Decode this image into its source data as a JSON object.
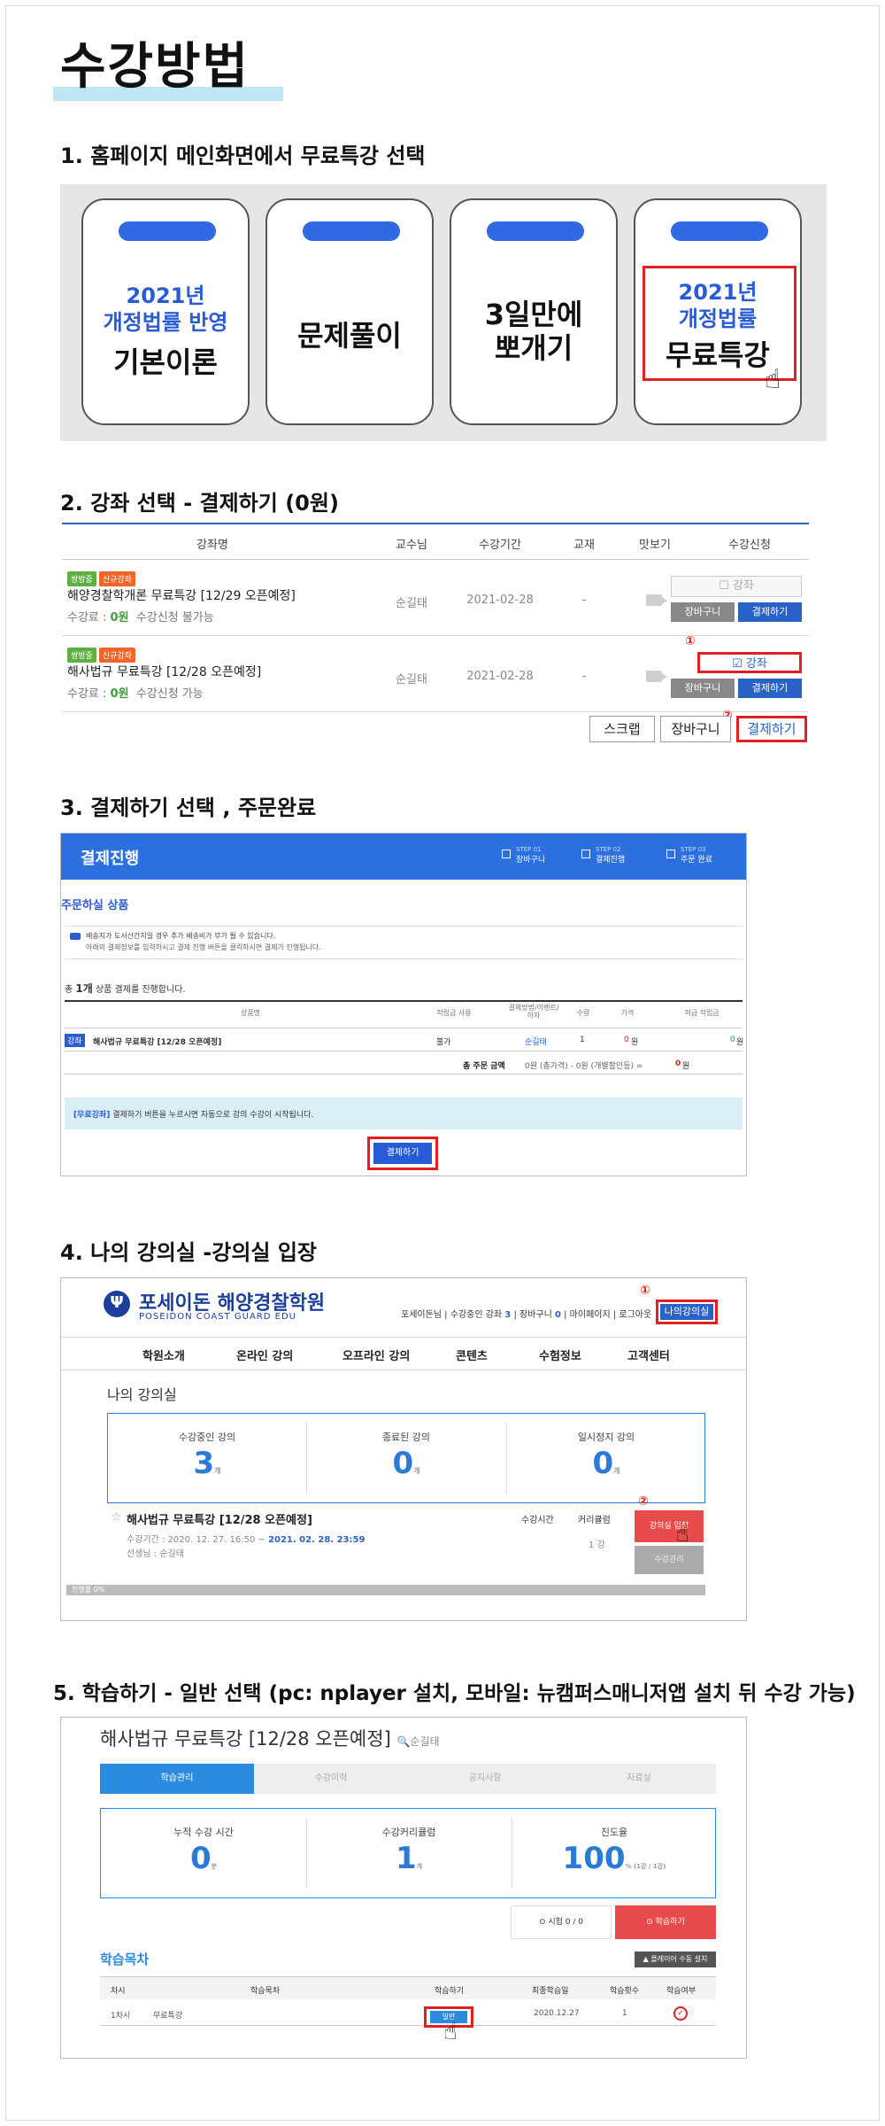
{
  "title": "수강방법",
  "steps": {
    "s1": "1. 홈페이지 메인화면에서 무료특강 선택",
    "s2": "2. 강좌 선택 - 결제하기 (0원)",
    "s3": "3. 결제하기 선택 , 주문완료",
    "s4": "4. 나의 강의실 -강의실 입장",
    "s5": "5. 학습하기 - 일반 선택 (pc: nplayer 설치, 모바일: 뉴캠퍼스매니저앱 설치 뒤 수강 가능)"
  },
  "cards": [
    {
      "blue1": "2021년",
      "blue2": "개정법률 반영",
      "black": "기본이론"
    },
    {
      "black": "문제풀이"
    },
    {
      "black1": "3일만에",
      "black2": "뽀개기"
    },
    {
      "blue1": "2021년",
      "blue2": "개정법률",
      "black": "무료특강"
    }
  ],
  "table2": {
    "headers": [
      "강좌명",
      "교수님",
      "수강기간",
      "교재",
      "맛보기",
      "수강신청"
    ],
    "rows": [
      {
        "badge1": "쌍방중",
        "badge2": "신규강좌",
        "name": "해양경찰학개론 무료특강 [12/29 오픈예정]",
        "fee_label": "수강료 : ",
        "fee": "0원",
        "status": "수강신청 불가능",
        "prof": "순길태",
        "date": "2021-02-28",
        "book": "-",
        "chk": "강좌",
        "cart": "장바구니",
        "pay": "결제하기"
      },
      {
        "badge1": "쌍방중",
        "badge2": "신규강좌",
        "name": "해사법규 무료특강 [12/28 오픈예정]",
        "fee_label": "수강료 : ",
        "fee": "0원",
        "status": "수강신청 가능",
        "prof": "순길태",
        "date": "2021-02-28",
        "book": "-",
        "chk": "강좌",
        "cart": "장바구니",
        "pay": "결제하기"
      }
    ],
    "mark1": "①",
    "mark2": "②",
    "btn_scrap": "스크랩",
    "btn_cart": "장바구니",
    "btn_pay": "결제하기"
  },
  "s3": {
    "header": "결제진행",
    "steps": [
      {
        "small": "STEP 01",
        "label": "장바구니"
      },
      {
        "small": "STEP 02",
        "label": "결제진행"
      },
      {
        "small": "STEP 03",
        "label": "주문 완료"
      }
    ],
    "sub": "주문하실 상품",
    "note1": "배송지가 도서산간지일 경우 추가 배송비가 부가 될 수 있습니다.",
    "note2": "아래의 결제정보를 입력하시고 결제 진행 버튼을 클릭하시면 결제가 진행됩니다.",
    "count_pre": "총 ",
    "count": "1개",
    "count_post": " 상품 결제를 진행합니다.",
    "headers": [
      "상품명",
      "적립금 사용",
      "결제방법/이벤트/하자",
      "수량",
      "가격",
      "적급 적립금"
    ],
    "row": {
      "tag": "강좌",
      "name": "해사법규 무료특강 [12/28 오픈예정]",
      "use": "불가",
      "method": "순길태",
      "qty": "1",
      "price": "0",
      "price_unit": "원",
      "point": "0",
      "point_unit": "원"
    },
    "total_label": "총 주문 금액",
    "total_expr": "0원 (총가격) - 0원 (개별할인등) =",
    "total_value": "0",
    "total_unit": "원",
    "info_tag": "[무료강좌]",
    "info": "결제하기 버튼을 누르시면 자동으로 강의 수강이 시작됩니다.",
    "pay_btn": "결제하기"
  },
  "s4": {
    "logo_mark": "Ψ",
    "logo": "포세이돈 해양경찰학원",
    "logo_sub": "POSEIDON COAST GUARD EDU",
    "util_pre": "포세이돈님 | 수강중인 강좌 ",
    "util_count": "3",
    "util_mid": " | 장바구니 ",
    "util_cart": "0",
    "util_post": " | 마이페이지 | 로그아웃",
    "myclass": "나의강의실 >",
    "mark1": "①",
    "mark2": "②",
    "nav": [
      "학원소개",
      "온라인 강의",
      "오프라인 강의",
      "콘텐츠",
      "수험정보",
      "고객센터"
    ],
    "heading": "나의 강의실",
    "stats": [
      {
        "label": "수강중인 강의",
        "value": "3",
        "unit": "개"
      },
      {
        "label": "종료된 강의",
        "value": "0",
        "unit": "개"
      },
      {
        "label": "일시정지 강의",
        "value": "0",
        "unit": "개"
      }
    ],
    "course": "해사법규 무료특강 [12/28 오픈예정]",
    "period_pre": "수강기간 : 2020. 12. 27. 16:50 ~ ",
    "period_end": "2021. 02. 28. 23:59",
    "teacher": "선생님 : 순길태",
    "col_time": "수강시간",
    "col_curr": "커리큘럼",
    "curr_val": "1",
    "curr_unit": "강",
    "enter_btn": "강의실 입장",
    "manage_btn": "수강관리",
    "progress": "진행률 0%",
    "progress_pct": 0
  },
  "s5": {
    "title": "해사법규 무료특강 [12/28 오픈예정]",
    "teacher": "순길태",
    "tabs": [
      "학습관리",
      "수강이력",
      "공지사항",
      "자료실"
    ],
    "stats": [
      {
        "label": "누적 수강 시간",
        "value": "0",
        "unit": "분"
      },
      {
        "label": "수강커리큘럼",
        "value": "1",
        "unit": "개"
      },
      {
        "label": "진도율",
        "value": "100",
        "unit": "% (1강 / 1강)"
      }
    ],
    "exam": "⊙ 시험  0 / 0",
    "study": "⊙ 학습하기",
    "toc": "학습목차",
    "setting": "▲ 플레이어 수동 설치",
    "headers": [
      "차시",
      "학습목차",
      "학습하기",
      "최종학습일",
      "학습횟수",
      "학습여부"
    ],
    "row": {
      "no": "1차시",
      "name": "무료특강",
      "btn": "일반",
      "date": "2020.12.27",
      "count": "1",
      "done": "✓"
    }
  },
  "colors": {
    "accent": "#2a63c8",
    "highlight": "#e02020",
    "title_underline": "#bfe6f4"
  },
  "icons": [
    "hand-pointer-icon",
    "camera-icon",
    "checkbox-icon",
    "star-icon",
    "check-circle-icon"
  ]
}
